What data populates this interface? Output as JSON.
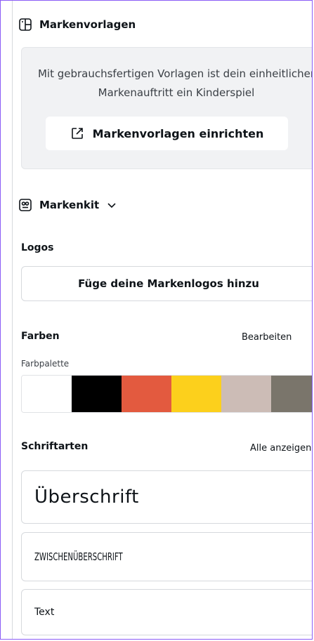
{
  "templates": {
    "title": "Markenvorlagen",
    "message": "Mit gebrauchsfertigen Vorlagen ist dein einheitlicher Markenauftritt ein Kinderspiel",
    "setup_button": "Markenvorlagen einrichten"
  },
  "brand_kit": {
    "title": "Markenkit"
  },
  "logos": {
    "heading": "Logos",
    "add_button": "Füge deine Markenlogos hinzu"
  },
  "colors": {
    "heading": "Farben",
    "edit_link": "Bearbeiten",
    "palette_label": "Farbpalette",
    "swatches": [
      "#ffffff",
      "#000000",
      "#e35a3f",
      "#fcd01c",
      "#ccbcb6",
      "#7a756b"
    ]
  },
  "fonts": {
    "heading": "Schriftarten",
    "show_all_link": "Alle anzeigen",
    "items": [
      "Überschrift",
      "ZWISCHENÜBERSCHRIFT",
      "Text"
    ]
  }
}
